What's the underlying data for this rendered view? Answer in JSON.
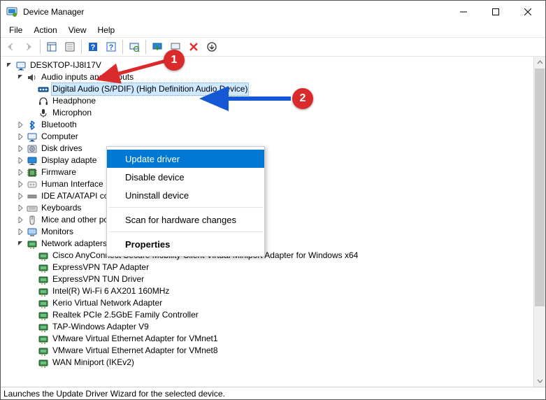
{
  "window": {
    "title": "Device Manager"
  },
  "menus": {
    "file": "File",
    "action": "Action",
    "view": "View",
    "help": "Help"
  },
  "tree": {
    "root": "DESKTOP-IJ8I17V",
    "audio_cat": "Audio inputs and outputs",
    "audio": {
      "digital": "Digital Audio (S/PDIF) (High Definition Audio Device)",
      "headphones": "Headphone",
      "microphone": "Microphon"
    },
    "bluetooth": "Bluetooth",
    "computer": "Computer",
    "disk": "Disk drives",
    "display": "Display adapte",
    "firmware": "Firmware",
    "hid": "Human Interface Devices",
    "ide": "IDE ATA/ATAPI controllers",
    "keyboards": "Keyboards",
    "mice": "Mice and other pointing devices",
    "monitors": "Monitors",
    "network_cat": "Network adapters",
    "net": {
      "cisco": "Cisco AnyConnect Secure Mobility Client Virtual Miniport Adapter for Windows x64",
      "expresstap": "ExpressVPN TAP Adapter",
      "expresstun": "ExpressVPN TUN Driver",
      "intel": "Intel(R) Wi-Fi 6 AX201 160MHz",
      "kerio": "Kerio Virtual Network Adapter",
      "realtek": "Realtek PCIe 2.5GbE Family Controller",
      "tap": "TAP-Windows Adapter V9",
      "vmnet1": "VMware Virtual Ethernet Adapter for VMnet1",
      "vmnet8": "VMware Virtual Ethernet Adapter for VMnet8",
      "wan": "WAN Miniport (IKEv2)"
    }
  },
  "context_menu": {
    "update": "Update driver",
    "disable": "Disable device",
    "uninstall": "Uninstall device",
    "scan": "Scan for hardware changes",
    "properties": "Properties"
  },
  "status": "Launches the Update Driver Wizard for the selected device.",
  "annotations": {
    "b1": "1",
    "b2": "2"
  }
}
